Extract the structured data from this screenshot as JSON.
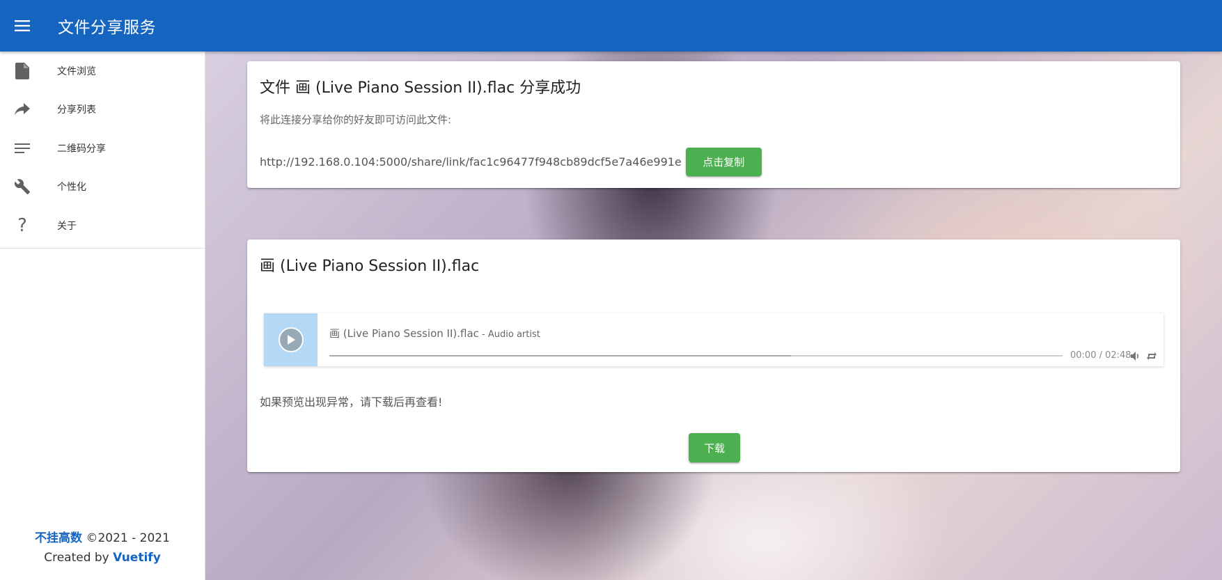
{
  "app": {
    "title": "文件分享服务"
  },
  "sidebar": {
    "items": [
      {
        "label": "文件浏览",
        "icon": "file-icon"
      },
      {
        "label": "分享列表",
        "icon": "share-icon"
      },
      {
        "label": "二维码分享",
        "icon": "list-lines-icon"
      },
      {
        "label": "个性化",
        "icon": "wrench-icon"
      },
      {
        "label": "关于",
        "icon": "question-icon"
      }
    ],
    "footer": {
      "brand": "不挂高数",
      "copyright": "©2021 - 2021",
      "created_by": "Created by",
      "framework": "Vuetify"
    }
  },
  "share_card": {
    "title": "文件 画 (Live Piano Session II).flac 分享成功",
    "hint": "将此连接分享给你的好友即可访问此文件:",
    "link": "http://192.168.0.104:5000/share/link/fac1c96477f948cb89dcf5e7a46e991e",
    "copy_label": "点击复制"
  },
  "preview_card": {
    "title": "画 (Live Piano Session II).flac",
    "player": {
      "track": "画 (Live Piano Session II).flac",
      "artist": " - Audio artist",
      "time": "00:00 / 02:48",
      "loaded_fraction": 0.63
    },
    "note": "如果预览出现异常，请下载后再查看!",
    "download_label": "下载"
  },
  "colors": {
    "appbar": "#1565c0",
    "accent_green": "#4caf50",
    "brand_blue": "#1565c0",
    "cover": "#b3d9f7"
  }
}
